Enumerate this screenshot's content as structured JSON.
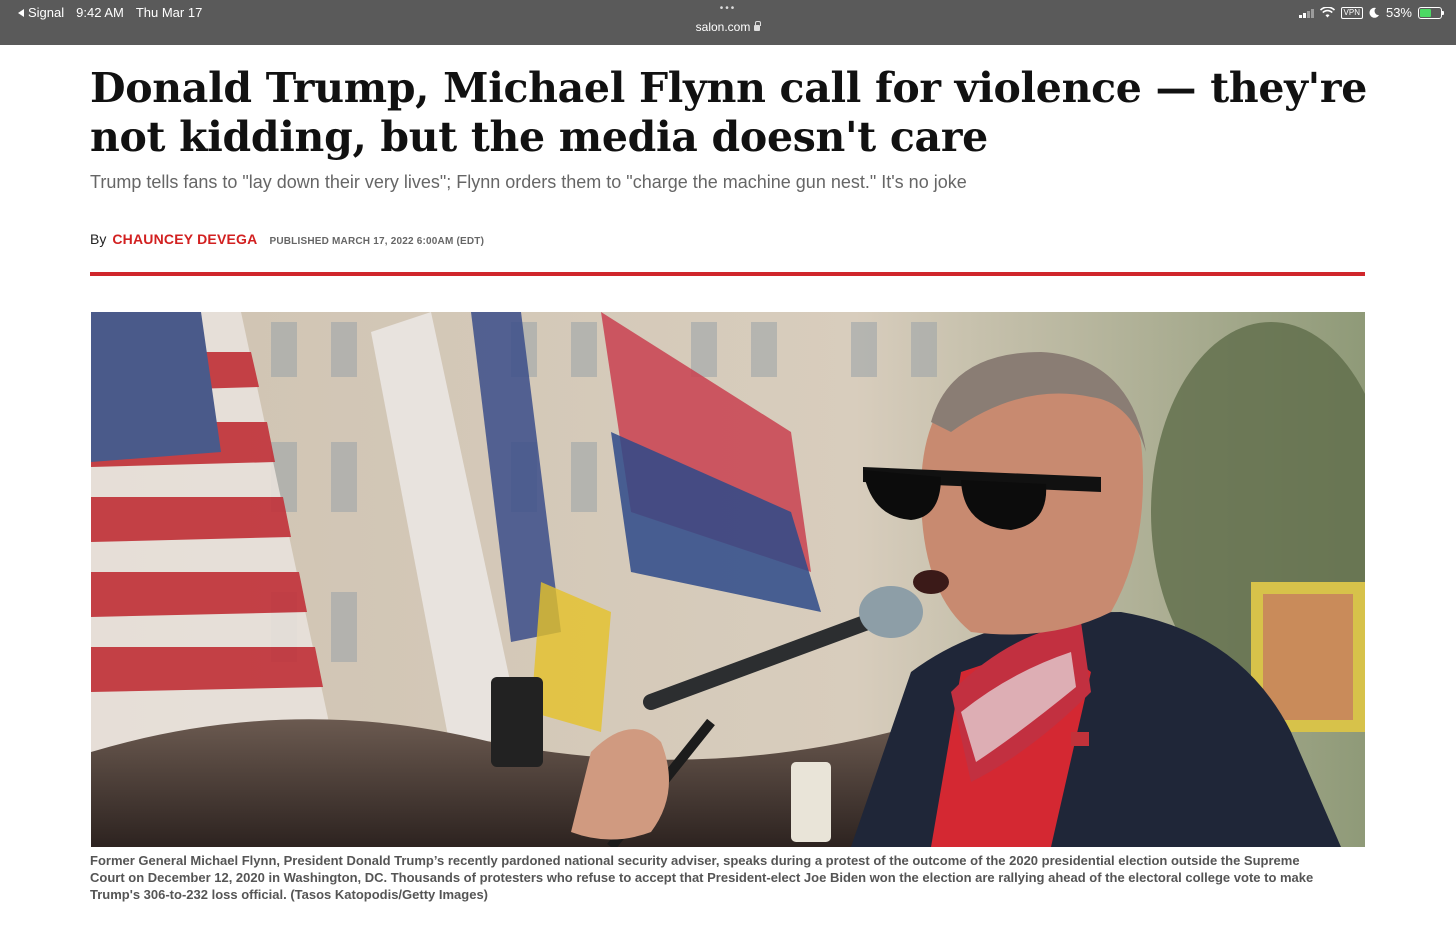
{
  "status_bar": {
    "back_app": "Signal",
    "time": "9:42 AM",
    "date": "Thu Mar 17",
    "url": "salon.com",
    "vpn": "VPN",
    "battery": "53%",
    "battery_level": 0.53
  },
  "article": {
    "headline": "Donald Trump, Michael Flynn call for violence — they're not kidding, but the media doesn't care",
    "dek": "Trump tells fans to \"lay down their very lives\"; Flynn orders them to \"charge the machine gun nest.\" It's no joke",
    "by_prefix": "By",
    "author": "CHAUNCEY DEVEGA",
    "published": "PUBLISHED MARCH 17, 2022 6:00AM (EDT)",
    "caption": "Former General Michael Flynn, President Donald Trump’s recently pardoned national security adviser, speaks during a protest of the outcome of the 2020 presidential election outside the Supreme Court on December 12, 2020 in Washington, DC. Thousands of protesters who refuse to accept that President-elect Joe Biden won the election are rallying ahead of the electoral college vote to make Trump's 306-to-232 loss official. (Tasos Katopodis/Getty Images)"
  },
  "colors": {
    "accent_red": "#d0262b",
    "author_red": "#d22020"
  }
}
